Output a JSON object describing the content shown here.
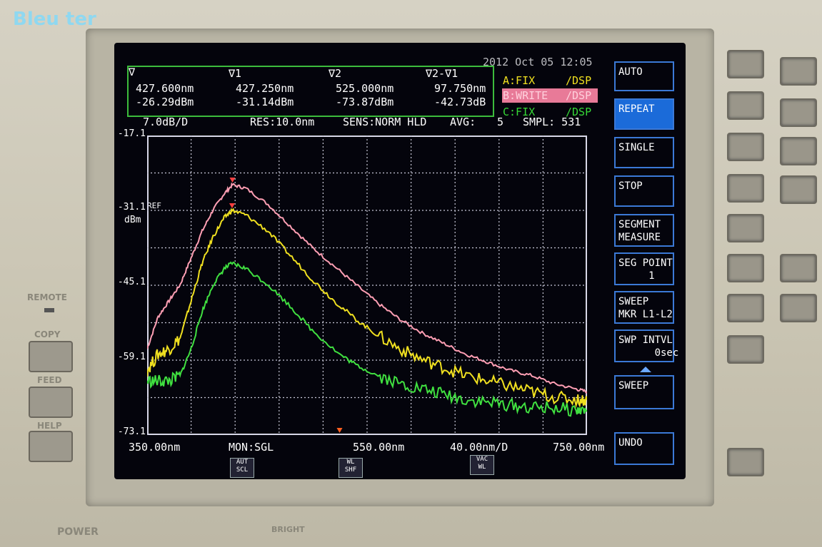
{
  "caption": "Bleu ter",
  "header": {
    "datetime": "2012 Oct 05 12:05",
    "markers": [
      {
        "label": "∇",
        "wavelength": "427.600nm",
        "level": "-26.29dBm"
      },
      {
        "label": "∇1",
        "wavelength": "427.250nm",
        "level": "-31.14dBm"
      },
      {
        "label": "∇2",
        "wavelength": "525.000nm",
        "level": "-73.87dBm"
      },
      {
        "label": "∇2-∇1",
        "wavelength": "97.750nm",
        "level": "-42.73dB"
      }
    ],
    "traces": [
      {
        "name": "A:FIX",
        "mode": "/DSP",
        "color": "#f0e020"
      },
      {
        "name": "B:WRITE",
        "mode": "/DSP",
        "color": "#ff7fa0"
      },
      {
        "name": "C:FIX",
        "mode": "/DSP",
        "color": "#36d836"
      }
    ],
    "scale": "7.0dB/D",
    "res": "RES:10.0nm",
    "sens": "SENS:NORM HLD",
    "avg": "AVG:",
    "avg_value": "5",
    "smpl": "SMPL: 531"
  },
  "footer": {
    "start": "350.00nm",
    "mon": "MON:SGL",
    "center": "550.00nm",
    "span": "40.00nm/D",
    "stop": "750.00nm",
    "soft_buttons": [
      "AUT\nSCL",
      "WL\nSHF",
      "VAC\nWL"
    ]
  },
  "menu": [
    {
      "label": "AUTO"
    },
    {
      "label": "REPEAT"
    },
    {
      "label": "SINGLE"
    },
    {
      "label": "STOP"
    },
    {
      "label": "SEGMENT\nMEASURE"
    },
    {
      "label": "SEG POINT\n     1"
    },
    {
      "label": "SWEEP\nMKR L1-L2"
    },
    {
      "label": "SWP INTVL\n      0sec"
    },
    {
      "label": "SWEEP"
    },
    {
      "label": "UNDO"
    }
  ],
  "panel": {
    "remote": "REMOTE",
    "copy": "COPY",
    "feed": "FEED",
    "help": "HELP",
    "power": "POWER",
    "bright": "BRIGHT"
  },
  "chart_data": {
    "type": "line",
    "xlim": [
      350,
      750
    ],
    "ylim": [
      -73.1,
      -17.1
    ],
    "y_ticks": [
      "-17.1",
      "-31.1",
      "-45.1",
      "-59.1",
      "-73.1"
    ],
    "ref_label": "REF",
    "y_unit": "dBm",
    "grid": true,
    "series": [
      {
        "color": "#ff9fb4",
        "x": [
          350,
          360,
          370,
          380,
          390,
          400,
          410,
          420,
          427.6,
          440,
          460,
          480,
          500,
          520,
          540,
          560,
          580,
          600,
          620,
          640,
          660,
          680,
          700,
          720,
          740,
          750
        ],
        "y": [
          -57,
          -51,
          -48,
          -45,
          -40,
          -35,
          -31,
          -28,
          -26.3,
          -27,
          -30,
          -34,
          -38,
          -41.5,
          -45,
          -48.5,
          -51.5,
          -54,
          -56,
          -58,
          -59.5,
          -61,
          -62,
          -63.5,
          -64.5,
          -65
        ]
      },
      {
        "color": "#f0e020",
        "x": [
          350,
          360,
          370,
          380,
          390,
          400,
          410,
          420,
          427.25,
          440,
          460,
          480,
          500,
          520,
          540,
          560,
          580,
          600,
          620,
          640,
          660,
          680,
          700,
          720,
          740,
          750
        ],
        "y": [
          -61,
          -58,
          -57,
          -55,
          -48,
          -41,
          -36,
          -32.5,
          -31.1,
          -32,
          -35,
          -39.5,
          -44,
          -48,
          -51.5,
          -54.5,
          -57,
          -59,
          -60.5,
          -62,
          -63,
          -64,
          -65,
          -66,
          -66.5,
          -66.5
        ]
      },
      {
        "color": "#40e040",
        "x": [
          350,
          360,
          370,
          380,
          390,
          400,
          410,
          420,
          427.25,
          440,
          460,
          480,
          500,
          525,
          540,
          560,
          580,
          600,
          620,
          640,
          660,
          680,
          700,
          720,
          740,
          750
        ],
        "y": [
          -63,
          -63,
          -63,
          -62,
          -57,
          -50,
          -45,
          -42,
          -41,
          -42,
          -45,
          -49,
          -53.5,
          -58,
          -60,
          -62,
          -63.5,
          -64.5,
          -65.5,
          -66.5,
          -67,
          -67.5,
          -68,
          -68,
          -68.5,
          -68.5
        ]
      }
    ]
  }
}
